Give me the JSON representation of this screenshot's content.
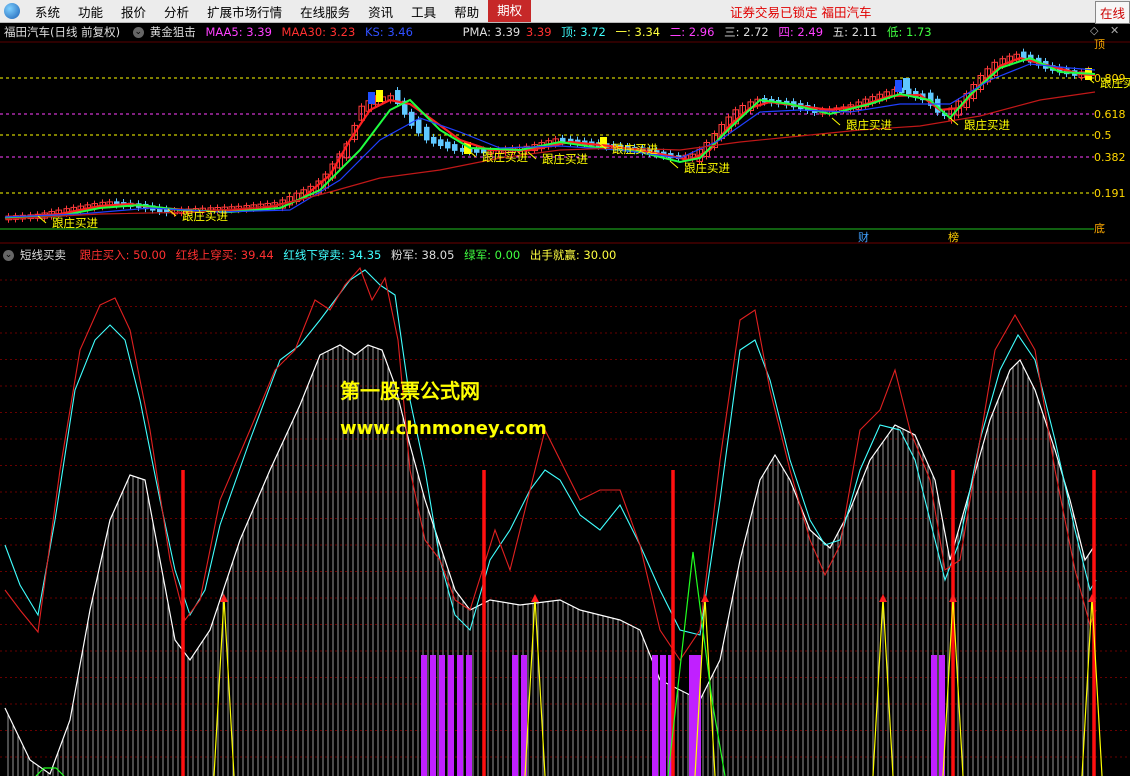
{
  "menu": {
    "items": [
      "系统",
      "功能",
      "报价",
      "分析",
      "扩展市场行情",
      "在线服务",
      "资讯",
      "工具",
      "帮助",
      "期权"
    ],
    "status": "证券交易已锁定  福田汽车",
    "online": "在线"
  },
  "top_panel": {
    "stock": "福田汽车(日线 前复权)",
    "indicator": "黄金狙击",
    "maa5": "MAA5: 3.39",
    "maa30": "MAA30: 3.23",
    "ks": "KS: 3.46",
    "pma": "PMA: 3.39",
    "pma2": "3.39",
    "ding": "顶: 3.72",
    "yi": "一: 3.34",
    "er": "二: 2.96",
    "san": "三: 2.72",
    "si": "四: 2.49",
    "wu": "五: 2.11",
    "di": "低: 1.73",
    "right_labels": [
      "顶",
      "0.809",
      "0.618",
      "0.5",
      "0.382",
      "0.191",
      "底"
    ],
    "signal_label": "跟庄买进",
    "markers": [
      "财",
      "榜"
    ]
  },
  "bottom_panel": {
    "indicator": "短线买卖",
    "gz": "跟庄买入: 50.00",
    "up": "红线上穿买: 39.44",
    "down": "红线下穿卖: 34.35",
    "fen": "粉军: 38.05",
    "lv": "绿军: 0.00",
    "cs": "出手就赢: 30.00",
    "watermark1": "第一股票公式网",
    "watermark2": "www.chnmoney.com"
  },
  "colors": {
    "up": "#ff3b3b",
    "down": "#60c8ff",
    "ma_red": "#ff2020",
    "ma_green": "#20ff40",
    "ma_blue": "#2040ff",
    "yellow": "#ffff00",
    "magenta": "#ff40ff",
    "cyan": "#40ffff",
    "bg": "#000000",
    "grid_red": "#8b0000",
    "accent": "#c62828"
  }
}
